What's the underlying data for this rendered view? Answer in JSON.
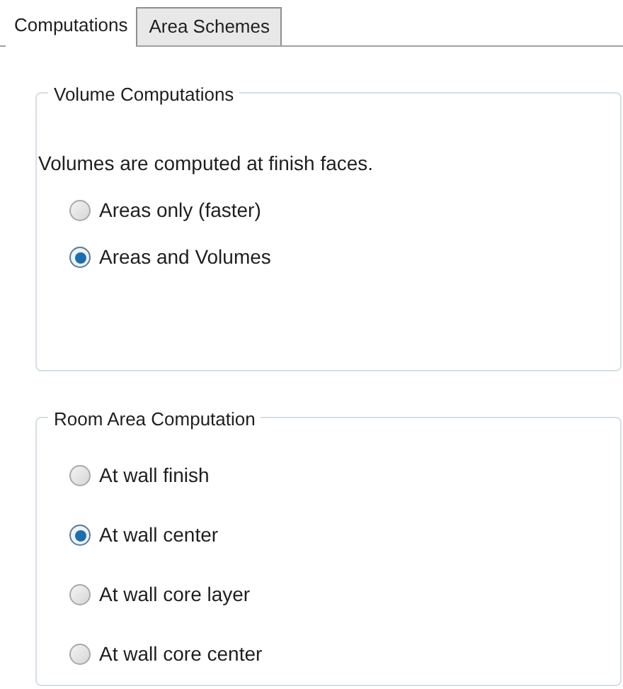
{
  "tabs": [
    {
      "label": "Computations",
      "selected": true
    },
    {
      "label": "Area Schemes",
      "selected": false
    }
  ],
  "volume_computations": {
    "title": "Volume Computations",
    "note": "Volumes are computed at finish faces.",
    "options": [
      {
        "label": "Areas only (faster)",
        "selected": false
      },
      {
        "label": "Areas and Volumes",
        "selected": true
      }
    ]
  },
  "room_area_computation": {
    "title": "Room Area Computation",
    "options": [
      {
        "label": "At wall finish",
        "selected": false
      },
      {
        "label": "At wall center",
        "selected": true
      },
      {
        "label": "At wall core layer",
        "selected": false
      },
      {
        "label": "At wall core center",
        "selected": false
      }
    ]
  }
}
